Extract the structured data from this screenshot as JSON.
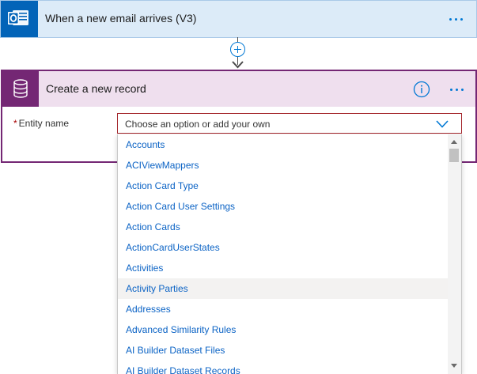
{
  "trigger": {
    "title": "When a new email arrives (V3)",
    "icon": "outlook-icon",
    "accent_color": "#0364b8"
  },
  "connector": {
    "add_icon": "plus-circle-icon",
    "arrow_icon": "arrow-down-icon"
  },
  "action": {
    "title": "Create a new record",
    "icon": "database-icon",
    "accent_color": "#742774",
    "info_icon": "info-icon",
    "more_icon": "more-dots-icon"
  },
  "entity_field": {
    "required_marker": "*",
    "label": "Entity name",
    "placeholder": "Choose an option or add your own",
    "chevron_icon": "chevron-down-icon"
  },
  "dropdown": {
    "options": [
      "Accounts",
      "ACIViewMappers",
      "Action Card Type",
      "Action Card User Settings",
      "Action Cards",
      "ActionCardUserStates",
      "Activities",
      "Activity Parties",
      "Addresses",
      "Advanced Similarity Rules",
      "AI Builder Dataset Files",
      "AI Builder Dataset Records"
    ],
    "highlighted_option": "Activity Parties"
  }
}
